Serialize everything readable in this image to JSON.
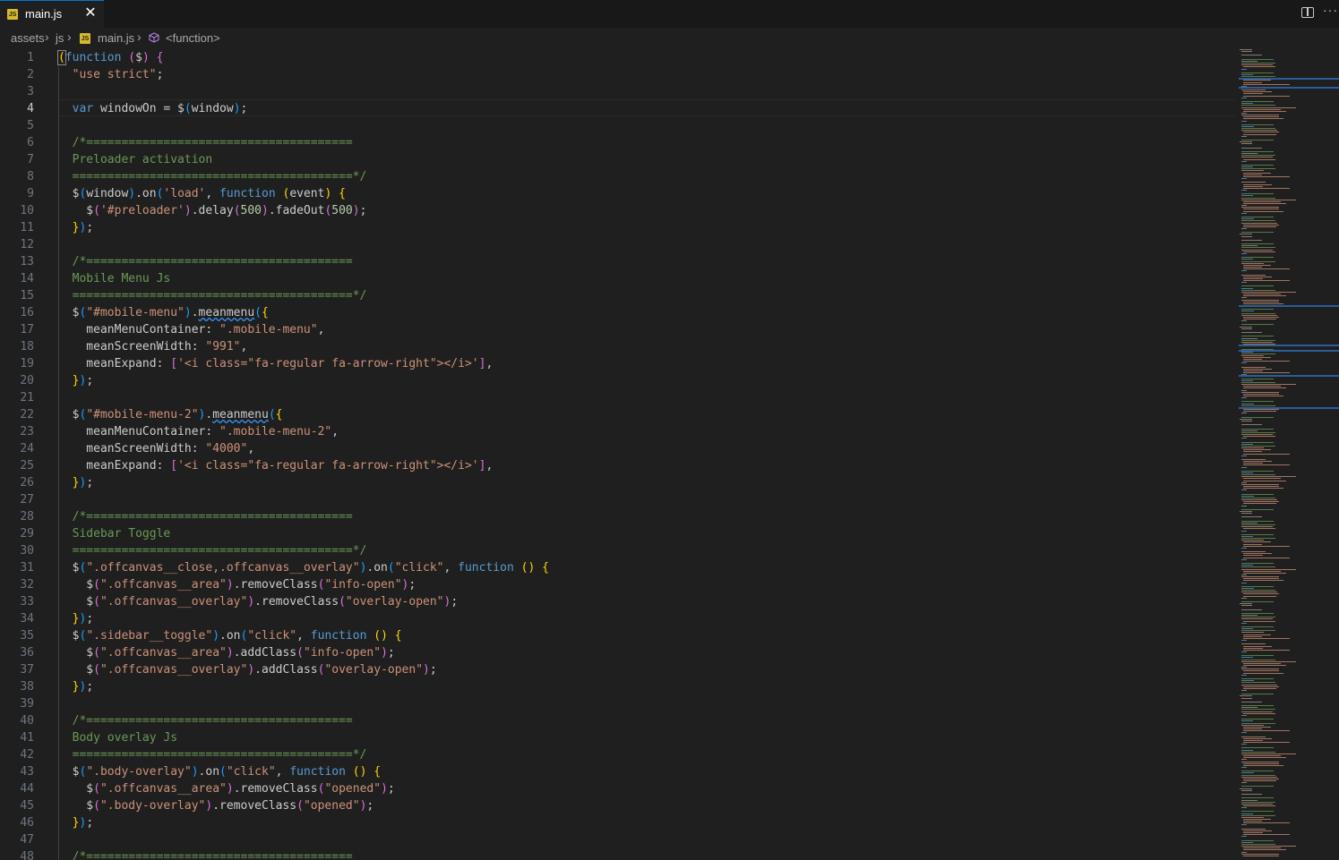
{
  "tab": {
    "label": "main.js",
    "icon": "js-file-icon",
    "badge_text": "JS",
    "close_glyph": "✕"
  },
  "toolbar": {
    "split_icon": "split-editor-icon",
    "more_glyph": "···"
  },
  "breadcrumb": {
    "items": [
      "assets",
      "js",
      "main.js",
      "<function>"
    ],
    "separator": "›"
  },
  "editor": {
    "active_line": 4,
    "line_numbers": [
      "1",
      "2",
      "3",
      "4",
      "5",
      "6",
      "7",
      "8",
      "9",
      "10",
      "11",
      "12",
      "13",
      "14",
      "15",
      "16",
      "17",
      "18",
      "19",
      "20",
      "21",
      "22",
      "23",
      "24",
      "25",
      "26",
      "27",
      "28",
      "29",
      "30",
      "31",
      "32",
      "33",
      "34",
      "35",
      "36",
      "37",
      "38",
      "39",
      "40",
      "41",
      "42",
      "43",
      "44",
      "45",
      "46",
      "47",
      "48"
    ],
    "lines": [
      "(function ($) {",
      "  \"use strict\";",
      "",
      "  var windowOn = $(window);",
      "",
      "  /*======================================",
      "  Preloader activation",
      "  ========================================*/",
      "  $(window).on('load', function (event) {",
      "    $('#preloader').delay(500).fadeOut(500);",
      "  });",
      "",
      "  /*======================================",
      "  Mobile Menu Js",
      "  ========================================*/",
      "  $(\"#mobile-menu\").meanmenu({",
      "    meanMenuContainer: \".mobile-menu\",",
      "    meanScreenWidth: \"991\",",
      "    meanExpand: ['<i class=\"fa-regular fa-arrow-right\"></i>'],",
      "  });",
      "",
      "  $(\"#mobile-menu-2\").meanmenu({",
      "    meanMenuContainer: \".mobile-menu-2\",",
      "    meanScreenWidth: \"4000\",",
      "    meanExpand: ['<i class=\"fa-regular fa-arrow-right\"></i>'],",
      "  });",
      "",
      "  /*======================================",
      "  Sidebar Toggle",
      "  ========================================*/",
      "  $(\".offcanvas__close,.offcanvas__overlay\").on(\"click\", function () {",
      "    $(\".offcanvas__area\").removeClass(\"info-open\");",
      "    $(\".offcanvas__overlay\").removeClass(\"overlay-open\");",
      "  });",
      "  $(\".sidebar__toggle\").on(\"click\", function () {",
      "    $(\".offcanvas__area\").addClass(\"info-open\");",
      "    $(\".offcanvas__overlay\").addClass(\"overlay-open\");",
      "  });",
      "",
      "  /*======================================",
      "  Body overlay Js",
      "  ========================================*/",
      "  $(\".body-overlay\").on(\"click\", function () {",
      "    $(\".offcanvas__area\").removeClass(\"opened\");",
      "    $(\".body-overlay\").removeClass(\"opened\");",
      "  });",
      "",
      "  /*======================================"
    ]
  },
  "colors": {
    "background": "#1f1f1f",
    "tabbar": "#181818",
    "keyword": "#569cd6",
    "string": "#ce9178",
    "comment": "#6a9955",
    "number": "#b5cea8",
    "bracket_1": "#ffd700",
    "bracket_2": "#da70d6",
    "bracket_3": "#179fff",
    "accent": "#0078d4"
  }
}
